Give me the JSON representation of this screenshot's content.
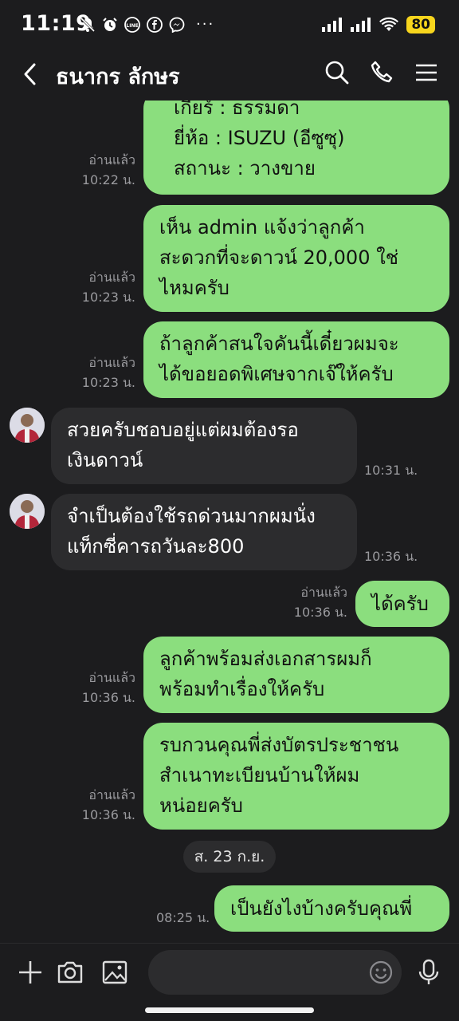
{
  "status_bar": {
    "time": "11:19",
    "notif_icons": [
      "muted-bell-icon",
      "alarm-icon",
      "line-app-icon",
      "facebook-icon",
      "messenger-icon"
    ],
    "more": "···",
    "battery": "80"
  },
  "header": {
    "contact_name": "ธนากร ลักษร"
  },
  "colors": {
    "background": "#1c1c1e",
    "outgoing_bubble": "#8bde7e",
    "incoming_bubble": "#2c2c2e",
    "battery": "#f7d51d"
  },
  "messages": [
    {
      "dir": "out",
      "lines": [
        "เกียร์ : ธรรมดา",
        "ยี่ห้อ : ISUZU (อีซูซุ)",
        "สถานะ : วางขาย"
      ],
      "read": "อ่านแล้ว",
      "time": "10:22 น."
    },
    {
      "dir": "out",
      "lines": [
        "เห็น admin แจ้งว่าลูกค้า",
        "สะดวกที่จะดาวน์ 20,000 ใช่",
        "ไหมครับ"
      ],
      "read": "อ่านแล้ว",
      "time": "10:23 น."
    },
    {
      "dir": "out",
      "lines": [
        "ถ้าลูกค้าสนใจคันนี้เดี๋ยวผมจะ",
        "ได้ขอยอดพิเศษจากเจ๊ให้ครับ"
      ],
      "read": "อ่านแล้ว",
      "time": "10:23 น."
    },
    {
      "dir": "in",
      "lines": [
        "สวยครับชอบอยู่แต่ผมต้องรอ",
        "เงินดาวน์"
      ],
      "time": "10:31 น."
    },
    {
      "dir": "in",
      "lines": [
        "จำเป็นต้องใช้รถด่วนมากผมนั่ง",
        "แท็กซี่คารถวันละ800"
      ],
      "time": "10:36 น."
    },
    {
      "dir": "out",
      "lines": [
        "ได้ครับ"
      ],
      "read": "อ่านแล้ว",
      "time": "10:36 น."
    },
    {
      "dir": "out",
      "lines": [
        "ลูกค้าพร้อมส่งเอกสารผมก็",
        "พร้อมทำเรื่องให้ครับ"
      ],
      "read": "อ่านแล้ว",
      "time": "10:36 น."
    },
    {
      "dir": "out",
      "lines": [
        "รบกวนคุณพี่ส่งบัตรประชาชน",
        "สำเนาทะเบียนบ้านให้ผม",
        "หน่อยครับ"
      ],
      "read": "อ่านแล้ว",
      "time": "10:36 น."
    },
    {
      "dir": "out",
      "lines": [
        "เป็นยังไงบ้างครับคุณพี่"
      ],
      "time": "08:25 น."
    }
  ],
  "date_separator": "ส. 23 ก.ย.",
  "input": {
    "value": "",
    "placeholder": ""
  }
}
